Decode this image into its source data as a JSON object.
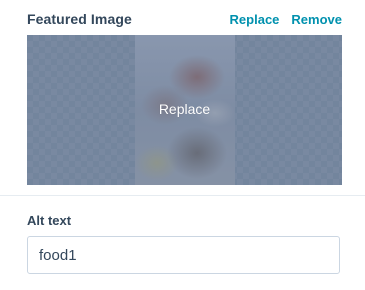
{
  "featured_image": {
    "title": "Featured Image",
    "replace_label": "Replace",
    "remove_label": "Remove",
    "overlay_label": "Replace"
  },
  "alt_text": {
    "label": "Alt text",
    "value": "food1"
  },
  "colors": {
    "accent": "#0091ae",
    "heading": "#33475b",
    "overlay": "#7f8fa4"
  }
}
